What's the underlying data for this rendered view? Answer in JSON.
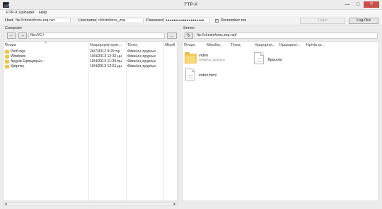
{
  "window": {
    "title": "FTP-X",
    "minimize": "—",
    "maximize": "□",
    "close": "✕"
  },
  "menu": [
    "FTP-X Uploader",
    "Help"
  ],
  "connection": {
    "host_label": "Host",
    "host_value": "ftp://christoforos.zxq.net",
    "username_label": "Username",
    "username_value": "christoforos_zxq",
    "password_label": "Password",
    "password_value": "●●●●●●●●●●●●●●●●●●●●",
    "remember_label": "Remember me",
    "remember_checked": true,
    "login_label": "Login",
    "logout_label": "Log Out"
  },
  "computer": {
    "label": "Computer",
    "back_icon": "arrow-left-icon",
    "forward_icon": "arrow-right-icon",
    "back_glyph": "←",
    "forward_glyph": "→",
    "path": "file:///C:/",
    "browse_label": "...",
    "columns": [
      "Όνομα",
      "Ημερομηνία τροπ...",
      "Τύπος",
      "Μέγεθ"
    ],
    "rows": [
      {
        "name": "PerfLogs",
        "date": "26/7/2012 9:29 πμ",
        "type": "Φάκελος αρχείων"
      },
      {
        "name": "Windows",
        "date": "10/4/2013 12:32 μμ",
        "type": "Φάκελος αρχείων"
      },
      {
        "name": "Αρχεία Εφαρμογών",
        "date": "10/4/2013 11:29 πμ",
        "type": "Φάκελος αρχείων"
      },
      {
        "name": "Χρήστες",
        "date": "10/4/2013 12:51 μμ",
        "type": "Φάκελος αρχείων"
      }
    ]
  },
  "server": {
    "label": "Server",
    "refresh_icon": "refresh-icon",
    "refresh_glyph": "↻",
    "path": "ftp://christoforos.zxq.net/",
    "columns": [
      "Όνομα",
      "Μέγεθος",
      "Τύπος",
      "Ημερομηνί...",
      "Ημερομηνί...",
      "Ημ/νία τρ..."
    ],
    "items": [
      {
        "name": "video",
        "sub": "Φάκελος αρχείων",
        "icon": "folder-icon"
      },
      {
        "name": ".ftpquota",
        "sub": "",
        "icon": "file-icon"
      },
      {
        "name": "index.html",
        "sub": "",
        "icon": "file-icon"
      }
    ]
  }
}
